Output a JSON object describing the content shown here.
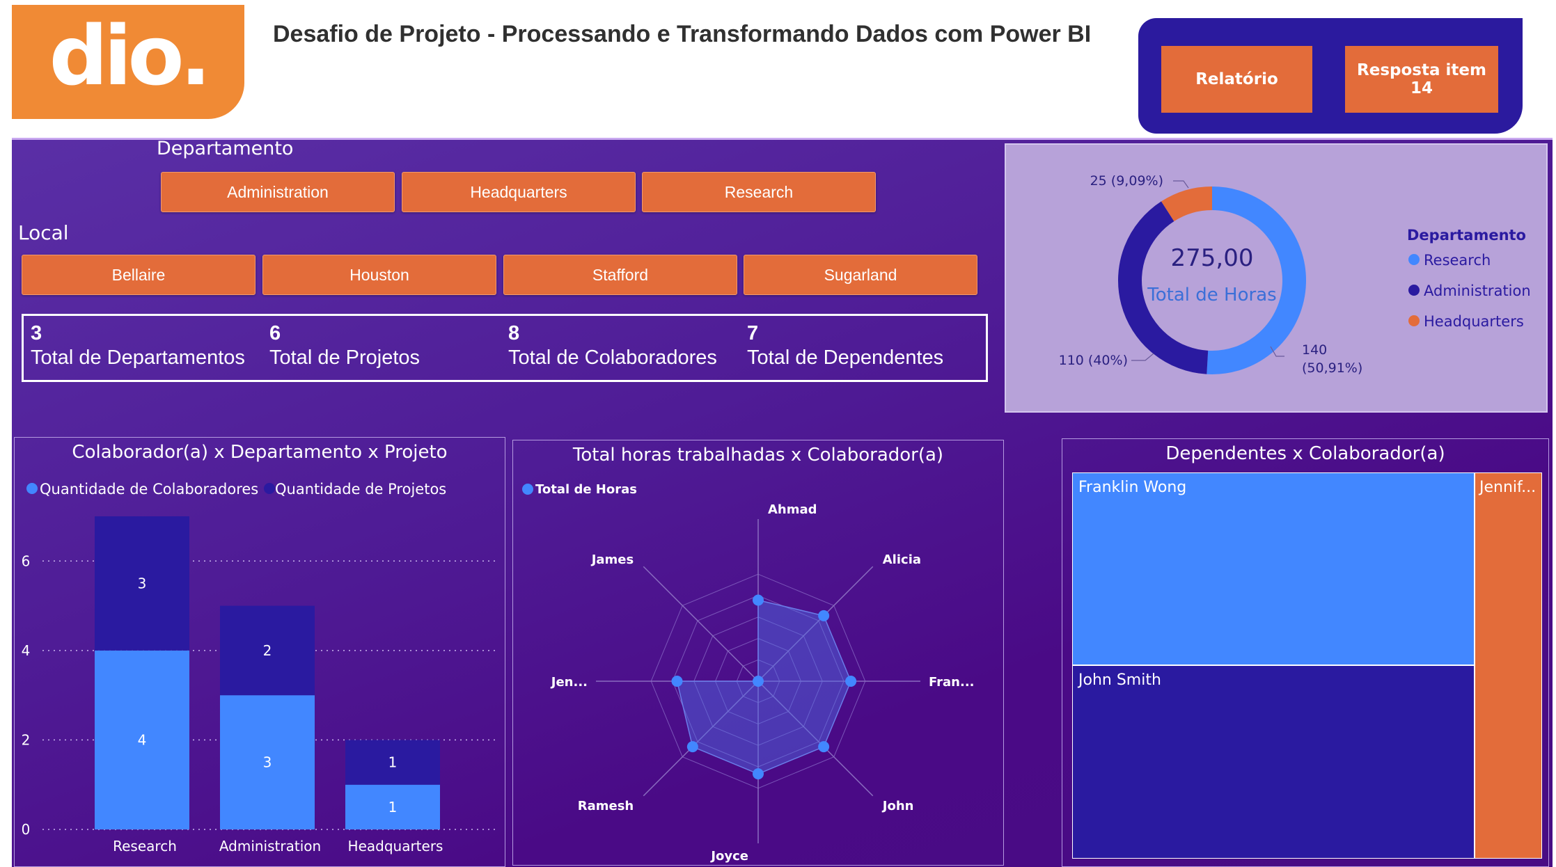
{
  "header": {
    "logo_text": "dio.",
    "title": "Desafio de Projeto - Processando e Transformando Dados com Power BI",
    "buttons": [
      "Relatório",
      "Resposta item 14"
    ]
  },
  "filters": {
    "departamento_label": "Departamento",
    "departamentos": [
      "Administration",
      "Headquarters",
      "Research"
    ],
    "local_label": "Local",
    "locais": [
      "Bellaire",
      "Houston",
      "Stafford",
      "Sugarland"
    ]
  },
  "kpis": [
    {
      "value": "3",
      "label": "Total de Departamentos"
    },
    {
      "value": "6",
      "label": "Total de Projetos"
    },
    {
      "value": "8",
      "label": "Total de Colaboradores"
    },
    {
      "value": "7",
      "label": "Total de Dependentes"
    }
  ],
  "colors": {
    "research": "#4287ff",
    "administration": "#2a1aa0",
    "headquarters": "#e36c3a"
  },
  "chart_data": [
    {
      "type": "pie",
      "variant": "donut",
      "center_value": "275,00",
      "center_label": "Total de Horas",
      "legend_title": "Departamento",
      "legend_position": "right",
      "slices": [
        {
          "name": "Research",
          "value": 140,
          "label_line1": "140",
          "label_line2": "(50,91%)"
        },
        {
          "name": "Administration",
          "value": 110,
          "label_line1": "110 (40%)",
          "label_line2": ""
        },
        {
          "name": "Headquarters",
          "value": 25,
          "label_line1": "25 (9,09%)",
          "label_line2": ""
        }
      ]
    },
    {
      "type": "bar",
      "stacked": true,
      "title": "Colaborador(a) x Departamento x Projeto",
      "legend_position": "top-left",
      "categories": [
        "Research",
        "Administration",
        "Headquarters"
      ],
      "series": [
        {
          "name": "Quantidade de Colaboradores",
          "values": [
            4,
            3,
            1
          ]
        },
        {
          "name": "Quantidade de Projetos",
          "values": [
            3,
            2,
            1
          ]
        }
      ],
      "ylim": [
        0,
        7
      ],
      "yticks": [
        "0",
        "2",
        "4",
        "6"
      ],
      "grid": true
    },
    {
      "type": "radar",
      "title": "Total horas trabalhadas x Colaborador(a)",
      "legend_position": "top-left",
      "series_name": "Total de Horas",
      "axes": [
        "Ahmad",
        "Alicia",
        "Fran...",
        "John",
        "Joyce",
        "Ramesh",
        "Jen...",
        "James"
      ],
      "values": [
        35,
        40,
        40,
        40,
        40,
        40,
        35,
        0
      ],
      "rmax": 70
    },
    {
      "type": "treemap",
      "title": "Dependentes x Colaborador(a)",
      "items": [
        {
          "name": "Franklin Wong",
          "value": 3
        },
        {
          "name": "John Smith",
          "value": 3
        },
        {
          "name": "Jennif...",
          "value": 1
        }
      ]
    }
  ]
}
